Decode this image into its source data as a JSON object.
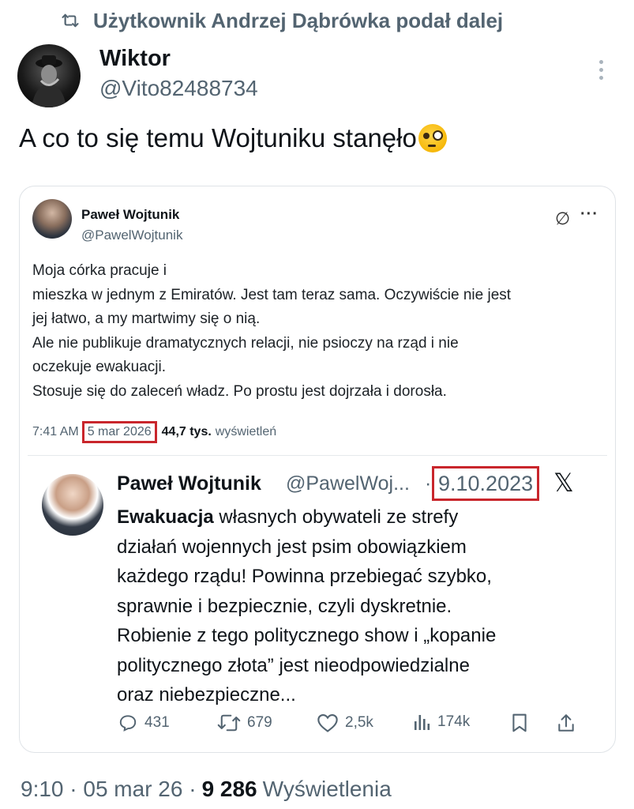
{
  "repost": {
    "text": "Użytkownik Andrzej Dąbrówka podał dalej",
    "icon": "repost-icon"
  },
  "author": {
    "name": "Wiktor",
    "handle": "@Vito82488734"
  },
  "tweet": {
    "text": "A co to się temu Wojtuniku stanęło",
    "emoji": "face-with-monocle"
  },
  "quoted_1": {
    "name": "Paweł Wojtunik",
    "handle": "@PawelWojtunik",
    "lines": [
      "Moja córka pracuje i",
      "mieszka w jednym z Emiratów. Jest tam teraz sama. Oczywiście nie jest",
      "jej łatwo, a my martwimy się o nią.",
      "Ale nie publikuje dramatycznych relacji, nie psioczy na rząd i nie",
      "oczekuje ewakuacji.",
      "Stosuje się do zaleceń władz. Po prostu jest dojrzała i dorosła."
    ],
    "time": "7:41 AM",
    "date": "5 mar 2026",
    "views_count": "44,7 tys.",
    "views_label": "wyświetleń"
  },
  "quoted_2": {
    "name": "Paweł Wojtunik",
    "handle": "@PawelWoj...",
    "separator": "·",
    "date": "9.10.2023",
    "first_bold": "Ewakuacja",
    "first_rest": " własnych obywateli ze strefy",
    "lines": [
      "działań wojennych jest psim obowiązkiem",
      "każdego rządu! Powinna przebiegać szybko,",
      "sprawnie i bezpiecznie, czyli dyskretnie.",
      "Robienie z tego politycznego show i „kopanie",
      "politycznego złota” jest nieodpowiedzialne",
      "oraz niebezpieczne..."
    ],
    "replies": "431",
    "reposts": "679",
    "likes": "2,5k",
    "views": "174k"
  },
  "footer": {
    "time_date": "9:10 · 05 mar 26 ·",
    "views_count": "9 286",
    "views_label": "Wyświetlenia"
  },
  "colors": {
    "highlight_box": "#c9262c",
    "secondary_text": "#536471",
    "primary_text": "#0f1419"
  }
}
